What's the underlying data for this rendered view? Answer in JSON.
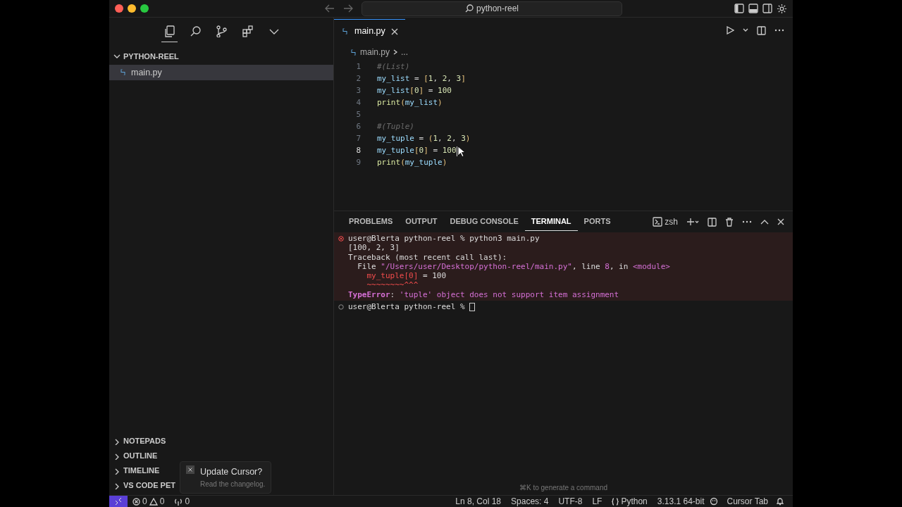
{
  "window": {
    "title": "python-reel"
  },
  "activity_bar": [
    {
      "kind": "files",
      "selected": true
    },
    {
      "kind": "search",
      "selected": false
    },
    {
      "kind": "source-control",
      "selected": false
    },
    {
      "kind": "extensions",
      "selected": false
    },
    {
      "kind": "more",
      "selected": false
    }
  ],
  "explorer": {
    "title": "PYTHON-REEL",
    "expanded": true,
    "files": [
      {
        "name": "main.py",
        "selected": true
      }
    ]
  },
  "sidebar_sections": [
    {
      "title": "NOTEPADS",
      "expanded": false
    },
    {
      "title": "OUTLINE",
      "expanded": false
    },
    {
      "title": "TIMELINE",
      "expanded": false
    },
    {
      "title": "VS CODE PET",
      "expanded": false
    }
  ],
  "notification": {
    "title": "Update Cursor?",
    "message": "Read the changelog."
  },
  "editor": {
    "tabs": [
      {
        "label": "main.py",
        "selected": true
      }
    ],
    "breadcrumb": [
      "main.py",
      "..."
    ],
    "lines": [
      {
        "n": "1",
        "current": false,
        "tokens": [
          {
            "t": "#(List)",
            "kind": "comment"
          }
        ]
      },
      {
        "n": "2",
        "current": false,
        "tokens": [
          {
            "t": "my_list",
            "kind": "var"
          },
          {
            "t": " = ",
            "kind": "op"
          },
          {
            "t": "[",
            "kind": "bracket"
          },
          {
            "t": "1",
            "kind": "num"
          },
          {
            "t": ", ",
            "kind": "op"
          },
          {
            "t": "2",
            "kind": "num"
          },
          {
            "t": ", ",
            "kind": "op"
          },
          {
            "t": "3",
            "kind": "num"
          },
          {
            "t": "]",
            "kind": "bracket"
          }
        ]
      },
      {
        "n": "3",
        "current": false,
        "tokens": [
          {
            "t": "my_list",
            "kind": "var"
          },
          {
            "t": "[",
            "kind": "bracket"
          },
          {
            "t": "0",
            "kind": "num"
          },
          {
            "t": "]",
            "kind": "bracket"
          },
          {
            "t": " = ",
            "kind": "op"
          },
          {
            "t": "100",
            "kind": "num"
          }
        ]
      },
      {
        "n": "4",
        "current": false,
        "tokens": [
          {
            "t": "print",
            "kind": "func"
          },
          {
            "t": "(",
            "kind": "bracket"
          },
          {
            "t": "my_list",
            "kind": "var"
          },
          {
            "t": ")",
            "kind": "bracket"
          }
        ]
      },
      {
        "n": "5",
        "current": false
      },
      {
        "n": "6",
        "current": false,
        "tokens": [
          {
            "t": "#(Tuple)",
            "kind": "comment"
          }
        ]
      },
      {
        "n": "7",
        "current": false,
        "tokens": [
          {
            "t": "my_tuple",
            "kind": "var"
          },
          {
            "t": " = ",
            "kind": "op"
          },
          {
            "t": "(",
            "kind": "bracket"
          },
          {
            "t": "1",
            "kind": "num"
          },
          {
            "t": ", ",
            "kind": "op"
          },
          {
            "t": "2",
            "kind": "num"
          },
          {
            "t": ", ",
            "kind": "op"
          },
          {
            "t": "3",
            "kind": "num"
          },
          {
            "t": ")",
            "kind": "bracket"
          }
        ]
      },
      {
        "n": "8",
        "current": true,
        "tokens": [
          {
            "t": "my_tuple",
            "kind": "var"
          },
          {
            "t": "[",
            "kind": "bracket"
          },
          {
            "t": "0",
            "kind": "num"
          },
          {
            "t": "]",
            "kind": "bracket"
          },
          {
            "t": " = ",
            "kind": "op"
          },
          {
            "t": "100",
            "kind": "num"
          }
        ]
      },
      {
        "n": "9",
        "current": false,
        "tokens": [
          {
            "t": "print",
            "kind": "func"
          },
          {
            "t": "(",
            "kind": "bracket"
          },
          {
            "t": "my_tuple",
            "kind": "var"
          },
          {
            "t": ")",
            "kind": "bracket"
          }
        ]
      }
    ]
  },
  "panel": {
    "tabs": [
      {
        "label": "PROBLEMS",
        "selected": false
      },
      {
        "label": "OUTPUT",
        "selected": false
      },
      {
        "label": "DEBUG CONSOLE",
        "selected": false
      },
      {
        "label": "TERMINAL",
        "selected": true
      },
      {
        "label": "PORTS",
        "selected": false
      }
    ],
    "shell": "zsh",
    "commands": [
      {
        "kind": "error",
        "prompt": "user@Blerta python-reel % ",
        "command": "python3 main.py",
        "output": [
          [
            {
              "t": "[100, 2, 3]",
              "kind": "plain"
            }
          ],
          [
            {
              "t": "Traceback (most recent call last):",
              "kind": "plain"
            }
          ],
          [
            {
              "t": "  File ",
              "kind": "plain"
            },
            {
              "t": "\"/Users/user/Desktop/python-reel/main.py\"",
              "kind": "magenta"
            },
            {
              "t": ", line ",
              "kind": "plain"
            },
            {
              "t": "8",
              "kind": "magenta"
            },
            {
              "t": ", in ",
              "kind": "plain"
            },
            {
              "t": "<module>",
              "kind": "magenta"
            }
          ],
          [
            {
              "t": "    my_tuple[0]",
              "kind": "red"
            },
            {
              "t": " = 100",
              "kind": "plain"
            }
          ],
          [
            {
              "t": "    ~~~~~~~~^^^",
              "kind": "red"
            }
          ],
          [
            {
              "t": "TypeError",
              "kind": "magenta-bold"
            },
            {
              "t": ": ",
              "kind": "plain"
            },
            {
              "t": "'tuple' object does not support item assignment",
              "kind": "magenta"
            }
          ]
        ]
      },
      {
        "kind": "pending",
        "prompt": "user@Blerta python-reel % "
      }
    ],
    "hint": "⌘K to generate a command"
  },
  "status_bar": {
    "errors": "0",
    "warnings": "0",
    "ports": "0",
    "position": "Ln 8, Col 18",
    "indent": "Spaces: 4",
    "encoding": "UTF-8",
    "eol": "LF",
    "language": "Python",
    "interpreter": "3.13.1 64-bit",
    "cursor_tab": "Cursor Tab"
  }
}
